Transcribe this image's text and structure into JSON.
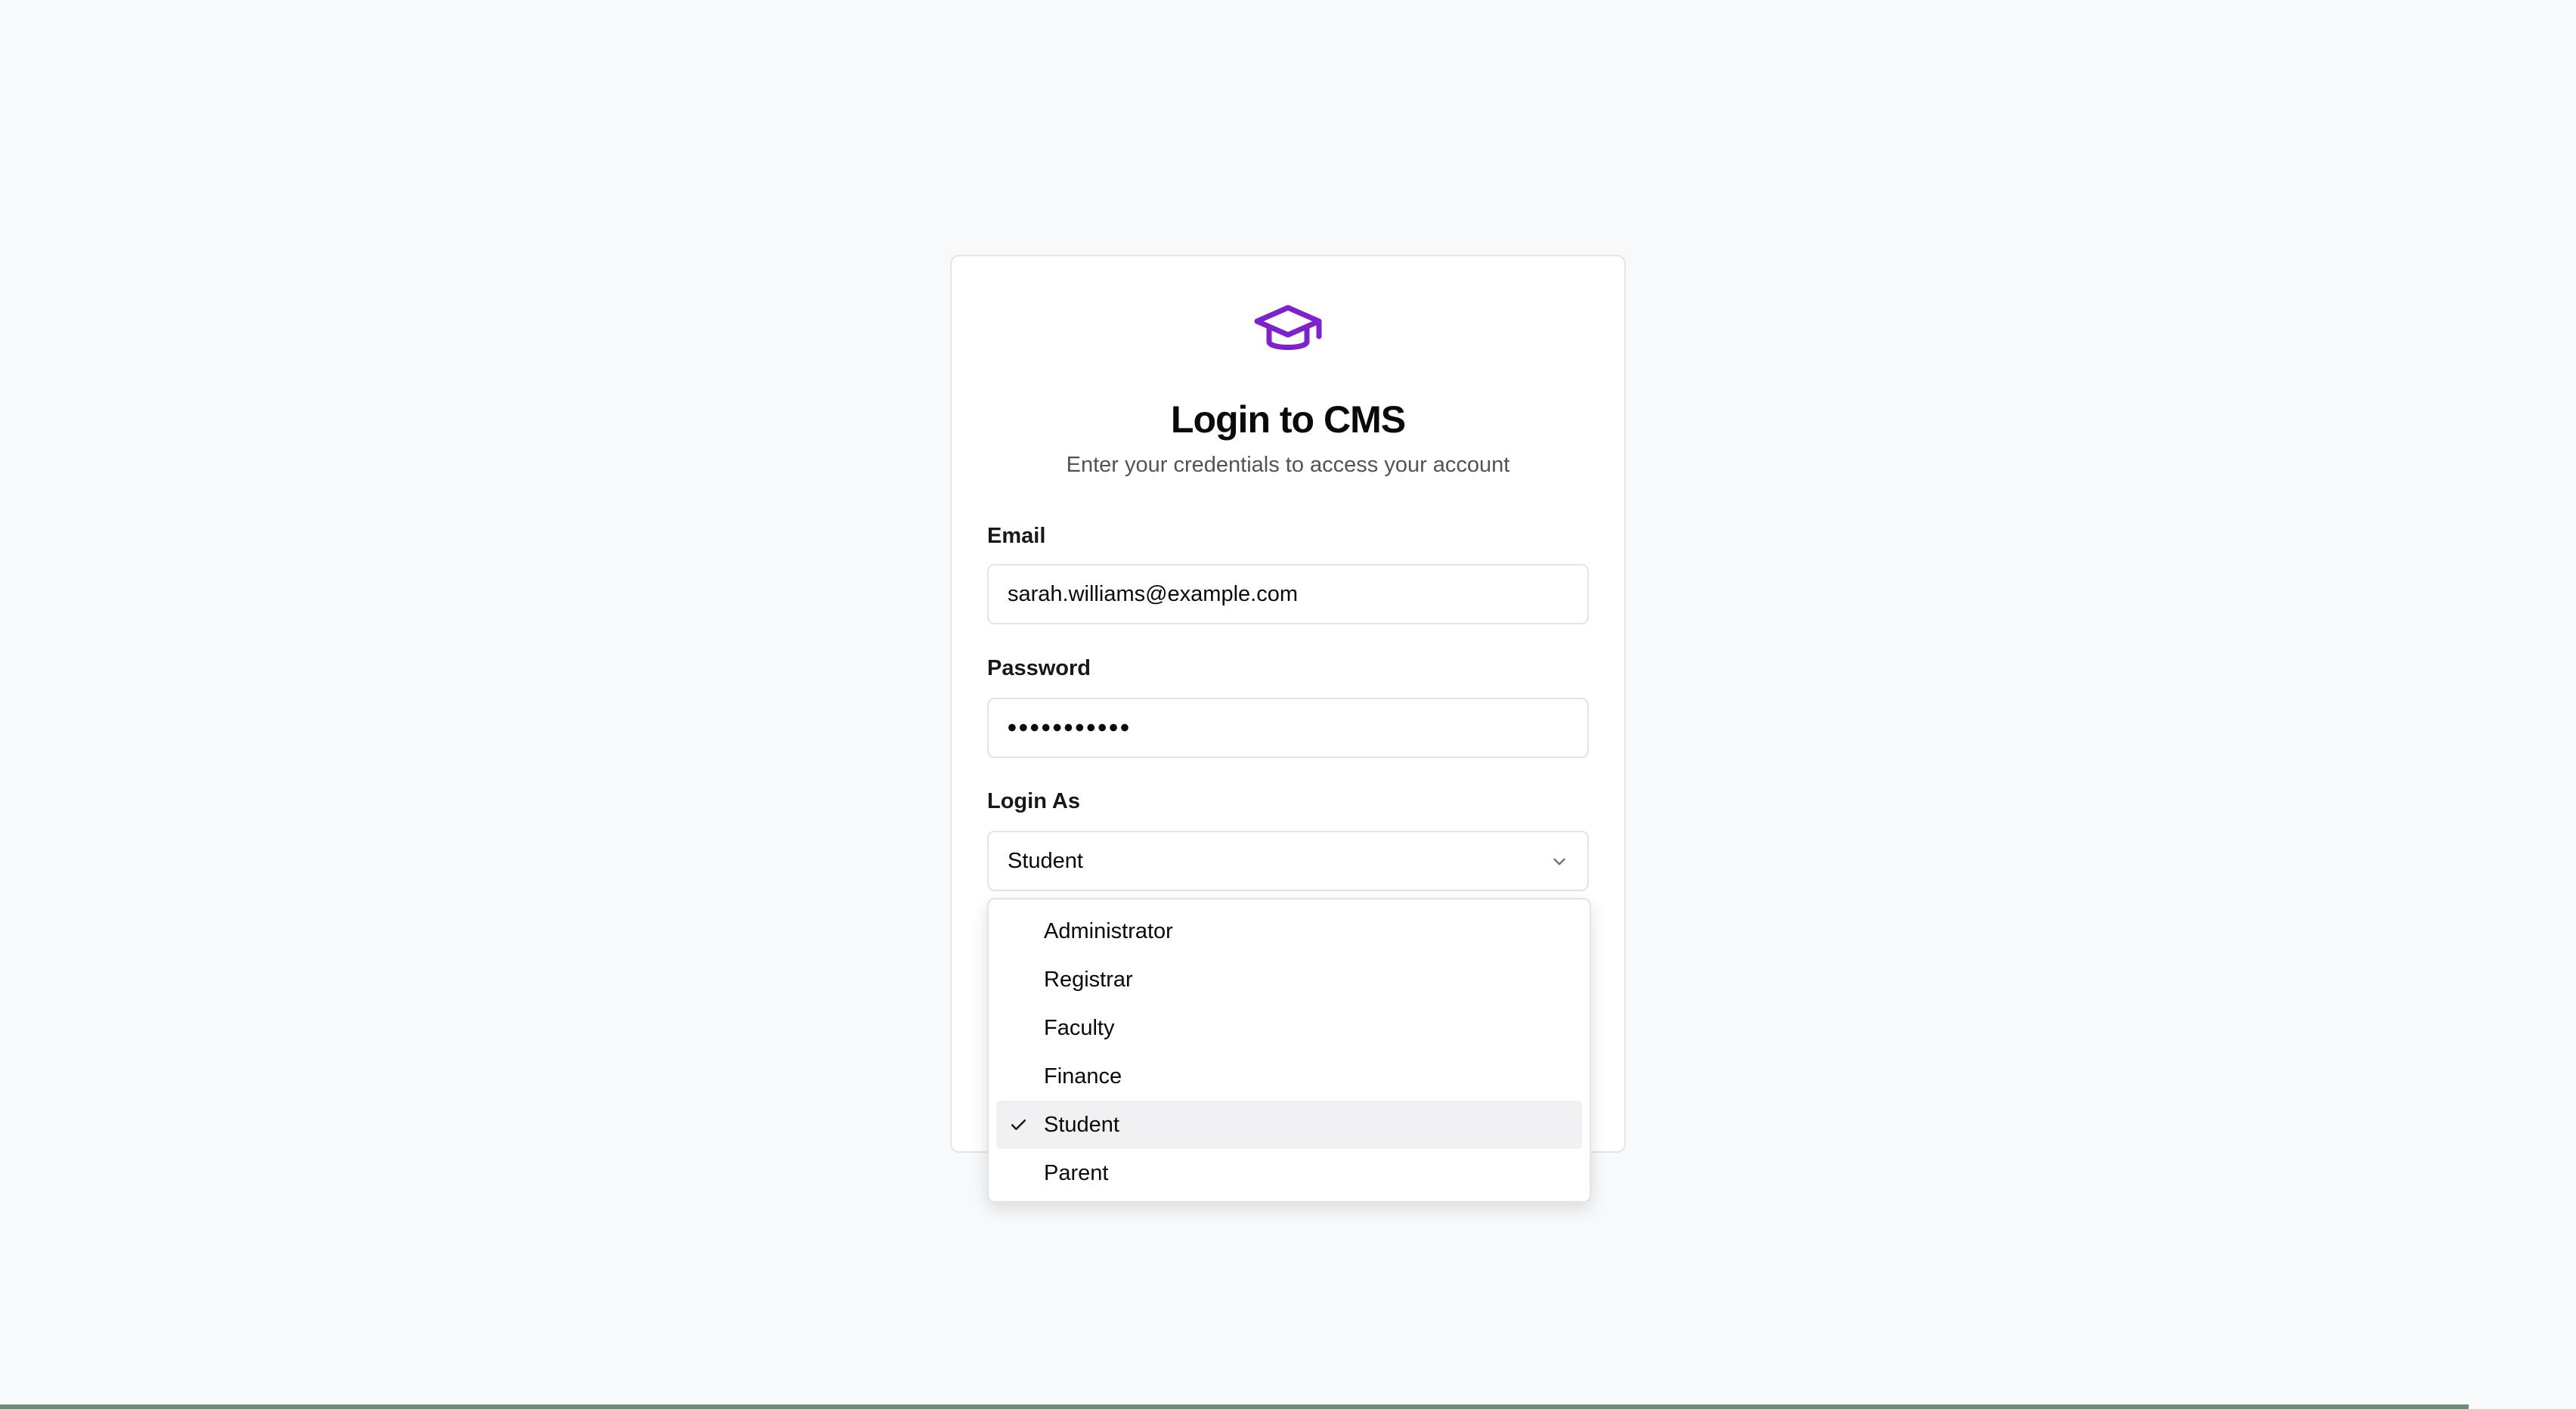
{
  "login": {
    "title": "Login to CMS",
    "subtitle": "Enter your credentials to access your account",
    "email_label": "Email",
    "email_value": "sarah.williams@example.com",
    "password_label": "Password",
    "password_value": "•••••••••••",
    "role_label": "Login As",
    "role_value": "Student"
  },
  "dropdown": {
    "options": [
      {
        "label": "Administrator"
      },
      {
        "label": "Registrar"
      },
      {
        "label": "Faculty"
      },
      {
        "label": "Finance"
      },
      {
        "label": "Student",
        "selected": true
      },
      {
        "label": "Parent"
      }
    ]
  },
  "icons": {
    "logo": "graduation-cap-icon",
    "select_chevron": "chevron-down-icon",
    "selected_check": "check-icon"
  },
  "colors": {
    "brand": "#7e22ce",
    "background": "#f8f9fa",
    "card": "#ffffff",
    "border": "#e4e4e7",
    "selected_option": "#f1f1f3"
  }
}
